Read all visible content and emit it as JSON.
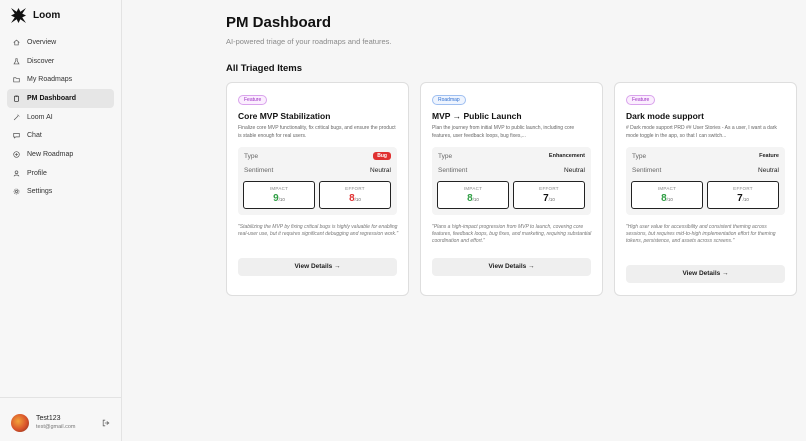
{
  "app": {
    "name": "Loom"
  },
  "nav": [
    {
      "label": "Overview",
      "icon": "home-icon"
    },
    {
      "label": "Discover",
      "icon": "flask-icon"
    },
    {
      "label": "My Roadmaps",
      "icon": "folder-icon"
    },
    {
      "label": "PM Dashboard",
      "icon": "clipboard-icon",
      "active": true
    },
    {
      "label": "Loom AI",
      "icon": "wand-icon"
    },
    {
      "label": "Chat",
      "icon": "chat-icon"
    },
    {
      "label": "New Roadmap",
      "icon": "plus-circle-icon"
    },
    {
      "label": "Profile",
      "icon": "user-icon"
    },
    {
      "label": "Settings",
      "icon": "gear-icon"
    }
  ],
  "user": {
    "name": "Test123",
    "email": "test@gmail.com"
  },
  "page": {
    "title": "PM Dashboard",
    "subtitle": "AI-powered triage of your roadmaps and features.",
    "section_title": "All Triaged Items"
  },
  "labels": {
    "type": "Type",
    "sentiment": "Sentiment",
    "impact": "IMPACT",
    "effort": "EFFORT",
    "out_of": "/10",
    "view_details": "View Details →"
  },
  "colors": {
    "impact": "#2f9e44",
    "effort": "#e03131",
    "effort_dark": "#111111"
  },
  "cards": [
    {
      "badge": "Feature",
      "badge_kind": "feature",
      "title": "Core MVP Stabilization",
      "description": "Finalize core MVP functionality, fix critical bugs, and ensure the product is stable enough for real users.",
      "type": "Bug",
      "sentiment": "Neutral",
      "impact": "9",
      "effort": "8",
      "rationale": "\"Stabilizing the MVP by fixing critical bugs is highly valuable for enabling real-user use, but it requires significant debugging and regression work.\""
    },
    {
      "badge": "Roadmap",
      "badge_kind": "roadmap",
      "title": "MVP → Public Launch",
      "description": "Plan the journey from initial MVP to public launch, including core features, user feedback loops, bug fixes,...",
      "type": "Enhancement",
      "sentiment": "Neutral",
      "impact": "8",
      "effort": "7",
      "rationale": "\"Plans a high-impact progression from MVP to launch, covering core features, feedback loops, bug fixes, and marketing, requiring substantial coordination and effort.\""
    },
    {
      "badge": "Feature",
      "badge_kind": "feature",
      "title": "Dark mode support",
      "description": "# Dark mode support PRD ## User Stories - As a user, I want a dark mode toggle in the app, so that I can switch...",
      "type": "Feature",
      "sentiment": "Neutral",
      "impact": "8",
      "effort": "7",
      "rationale": "\"High user value for accessibility and consistent theming across sessions, but requires mid-to-high implementation effort for theming tokens, persistence, and assets across screens.\""
    }
  ]
}
